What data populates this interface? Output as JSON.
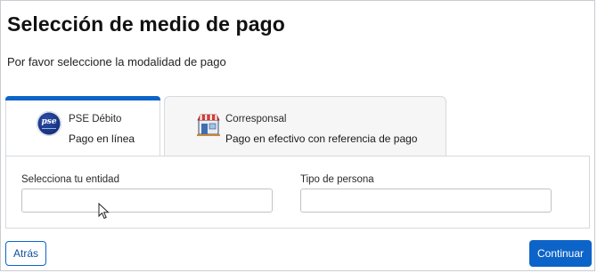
{
  "page": {
    "title": "Selección de medio de pago",
    "subtitle": "Por favor seleccione la modalidad de pago"
  },
  "tabs": [
    {
      "title": "PSE Débito",
      "subtitle": "Pago en línea",
      "icon": "pse-logo-icon",
      "logo_text": "pse",
      "selected": true
    },
    {
      "title": "Corresponsal",
      "subtitle": "Pago en efectivo con referencia de pago",
      "icon": "store-icon",
      "selected": false
    }
  ],
  "form": {
    "entidad": {
      "label": "Selecciona tu entidad",
      "value": "",
      "placeholder": ""
    },
    "persona": {
      "label": "Tipo de persona",
      "value": "",
      "placeholder": ""
    }
  },
  "actions": {
    "back_label": "Atrás",
    "continue_label": "Continuar"
  },
  "colors": {
    "accent": "#0d64c8",
    "inactive_tab_bg": "#f6f6f7",
    "border": "#d7d9dd"
  }
}
